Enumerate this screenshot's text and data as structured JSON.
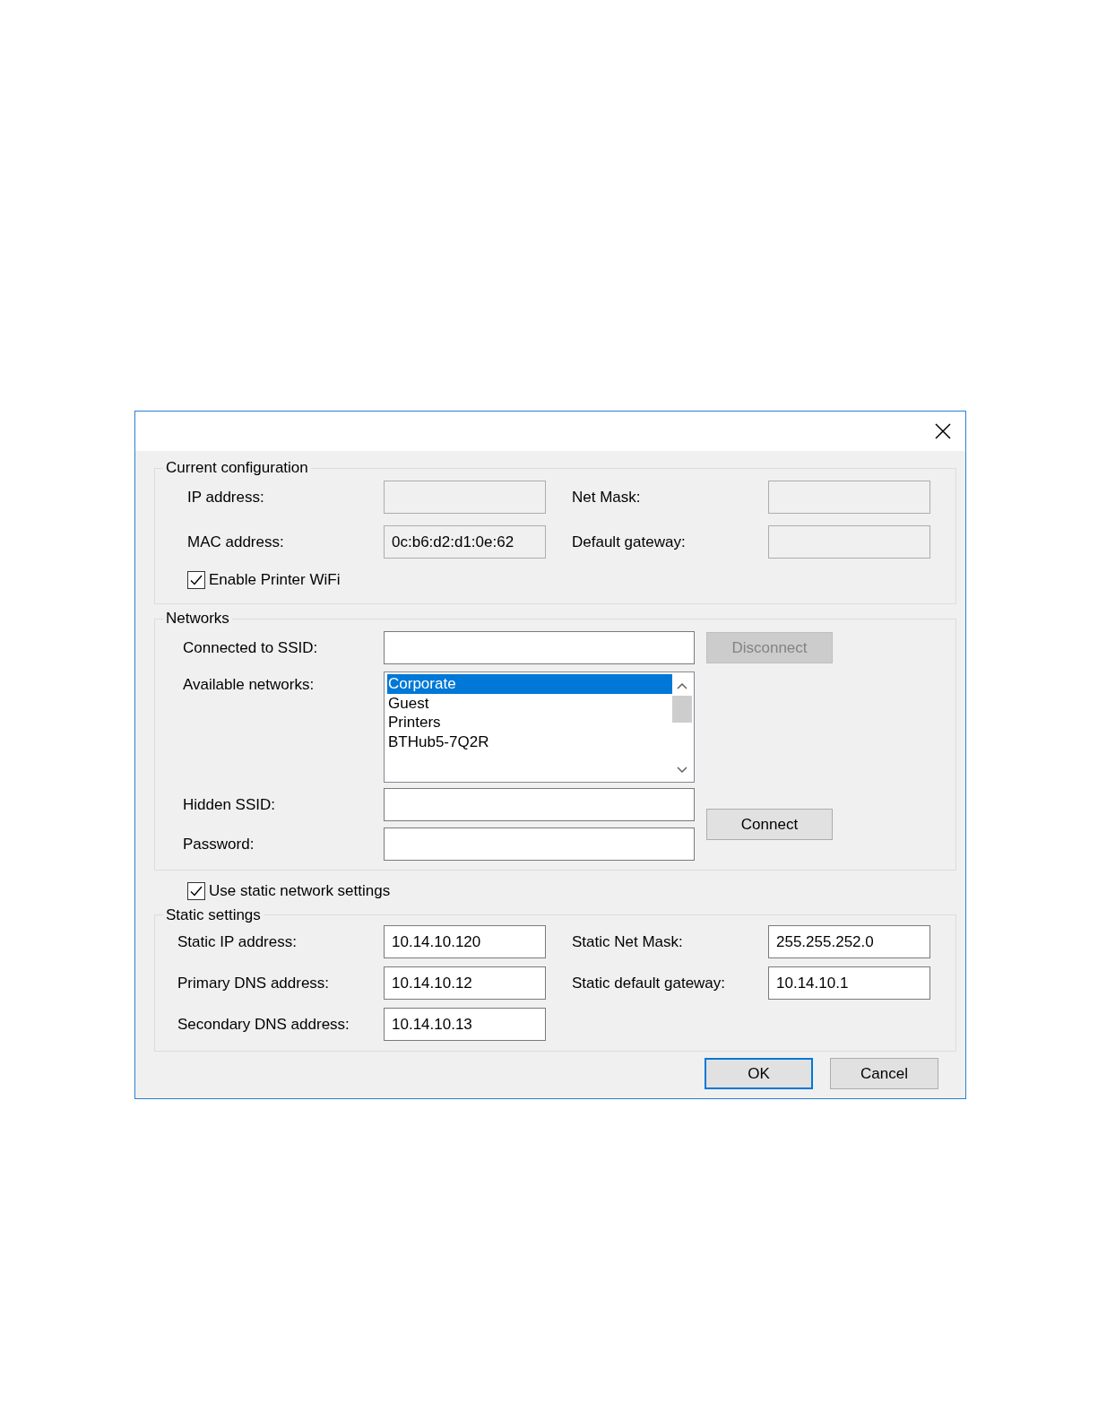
{
  "current_configuration": {
    "title": "Current configuration",
    "rows": [
      [
        {
          "label": "IP address:",
          "read_only": true
        },
        {
          "label": "Net Mask:",
          "read_only": true
        }
      ],
      [
        {
          "label": "MAC address:",
          "value": "0c:b6:d2:d1:0e:62",
          "read_only": true
        },
        {
          "label": "Default gateway:",
          "read_only": true
        }
      ]
    ]
  },
  "enable_wifi": {
    "label": "Enable Printer WiFi",
    "checked": true
  },
  "networks": {
    "title": "Networks",
    "connected_ssid": {
      "label": "Connected to SSID:",
      "read_only": false
    },
    "disconnect_button": {
      "label": "Disconnect",
      "disabled": true
    },
    "available_networks": {
      "label": "Available networks:",
      "items": [
        {
          "name": "Corporate",
          "selected": true
        },
        {
          "name": "Guest",
          "selected": false
        },
        {
          "name": "Printers",
          "selected": false
        },
        {
          "name": "BTHub5-7Q2R",
          "selected": false
        }
      ]
    },
    "hidden_ssid": {
      "label": "Hidden SSID:",
      "read_only": false
    },
    "password": {
      "label": "Password:",
      "read_only": false
    },
    "connect_button": {
      "label": "Connect",
      "disabled": false
    }
  },
  "use_static": {
    "label": "Use static network settings",
    "checked": true
  },
  "static_settings": {
    "title": "Static settings",
    "rows": [
      [
        {
          "label": "Static IP address:",
          "value": "10.14.10.120",
          "read_only": false
        },
        {
          "label": "Static Net Mask:",
          "value": "255.255.252.0",
          "read_only": false
        }
      ],
      [
        {
          "label": "Primary DNS address:",
          "value": "10.14.10.12",
          "read_only": false
        },
        {
          "label": "Static default gateway:",
          "value": "10.14.10.1",
          "read_only": false
        }
      ],
      [
        {
          "label": "Secondary DNS address:",
          "value": "10.14.10.13",
          "read_only": false
        }
      ]
    ]
  },
  "buttons": [
    {
      "label": "OK",
      "default": true
    },
    {
      "label": "Cancel",
      "default": false
    }
  ]
}
